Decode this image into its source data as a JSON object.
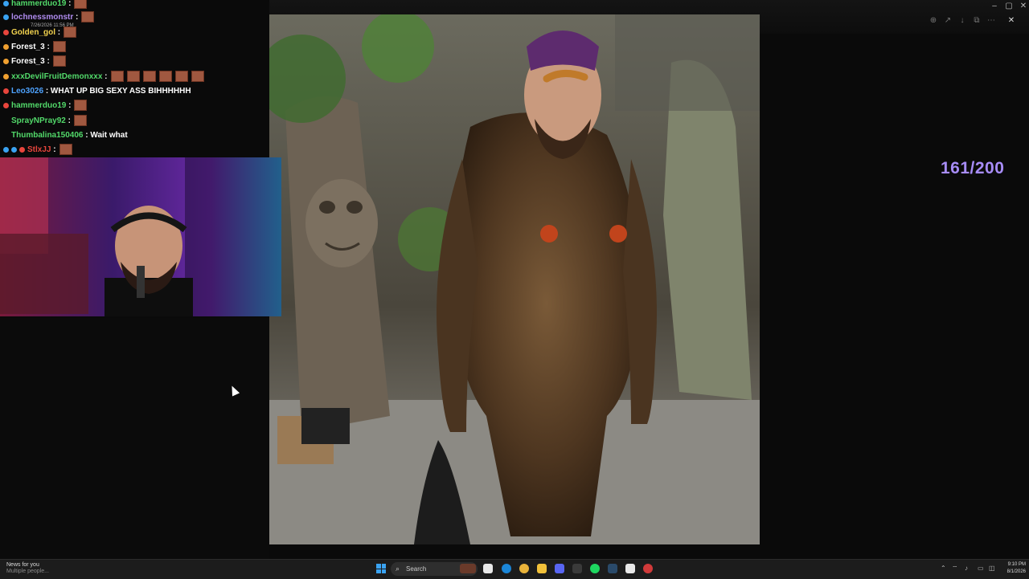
{
  "chat": {
    "lines": [
      {
        "user": "hammerduo19",
        "message": ":",
        "color": "#52d96a"
      },
      {
        "user": "lochnessmonstr",
        "message": ":",
        "color": "#b08cf0"
      },
      {
        "user": "Golden_gol",
        "message": ":",
        "color": "#f2d24e"
      },
      {
        "user": "Forest_3",
        "message": ":",
        "color": "#ffffff"
      },
      {
        "user": "Forest_3",
        "message": ":",
        "color": "#ffffff"
      },
      {
        "user": "xxxDevilFruitDemonxxx",
        "message": ":",
        "color": "#52d96a"
      },
      {
        "user": "Leo3026",
        "message": ": WHAT UP BIG SEXY ASS BIHHHHHH",
        "color": "#4ea3ff"
      },
      {
        "user": "hammerduo19",
        "message": ":",
        "color": "#52d96a"
      },
      {
        "user": "SprayNPray92",
        "message": ":",
        "color": "#52d96a"
      },
      {
        "user": "Thumbalina150406",
        "message": ": Wait what",
        "color": "#52d96a"
      },
      {
        "user": "StlxJJ",
        "message": ":",
        "color": "#e8453c"
      }
    ],
    "timestamp": "7/26/2026 11:56 PM"
  },
  "counter": "161/200",
  "taskbar": {
    "news_title": "News for you",
    "news_sub": "Multiple people...",
    "search_placeholder": "Search",
    "time": "9:10 PM",
    "date": "8/1/2026"
  },
  "icons": {
    "cursor": "mouse-pointer-icon",
    "start": "windows-start-icon",
    "search": "search-icon"
  },
  "colors": {
    "counter": "#a78cf7",
    "accent": "#3aa3f2"
  }
}
